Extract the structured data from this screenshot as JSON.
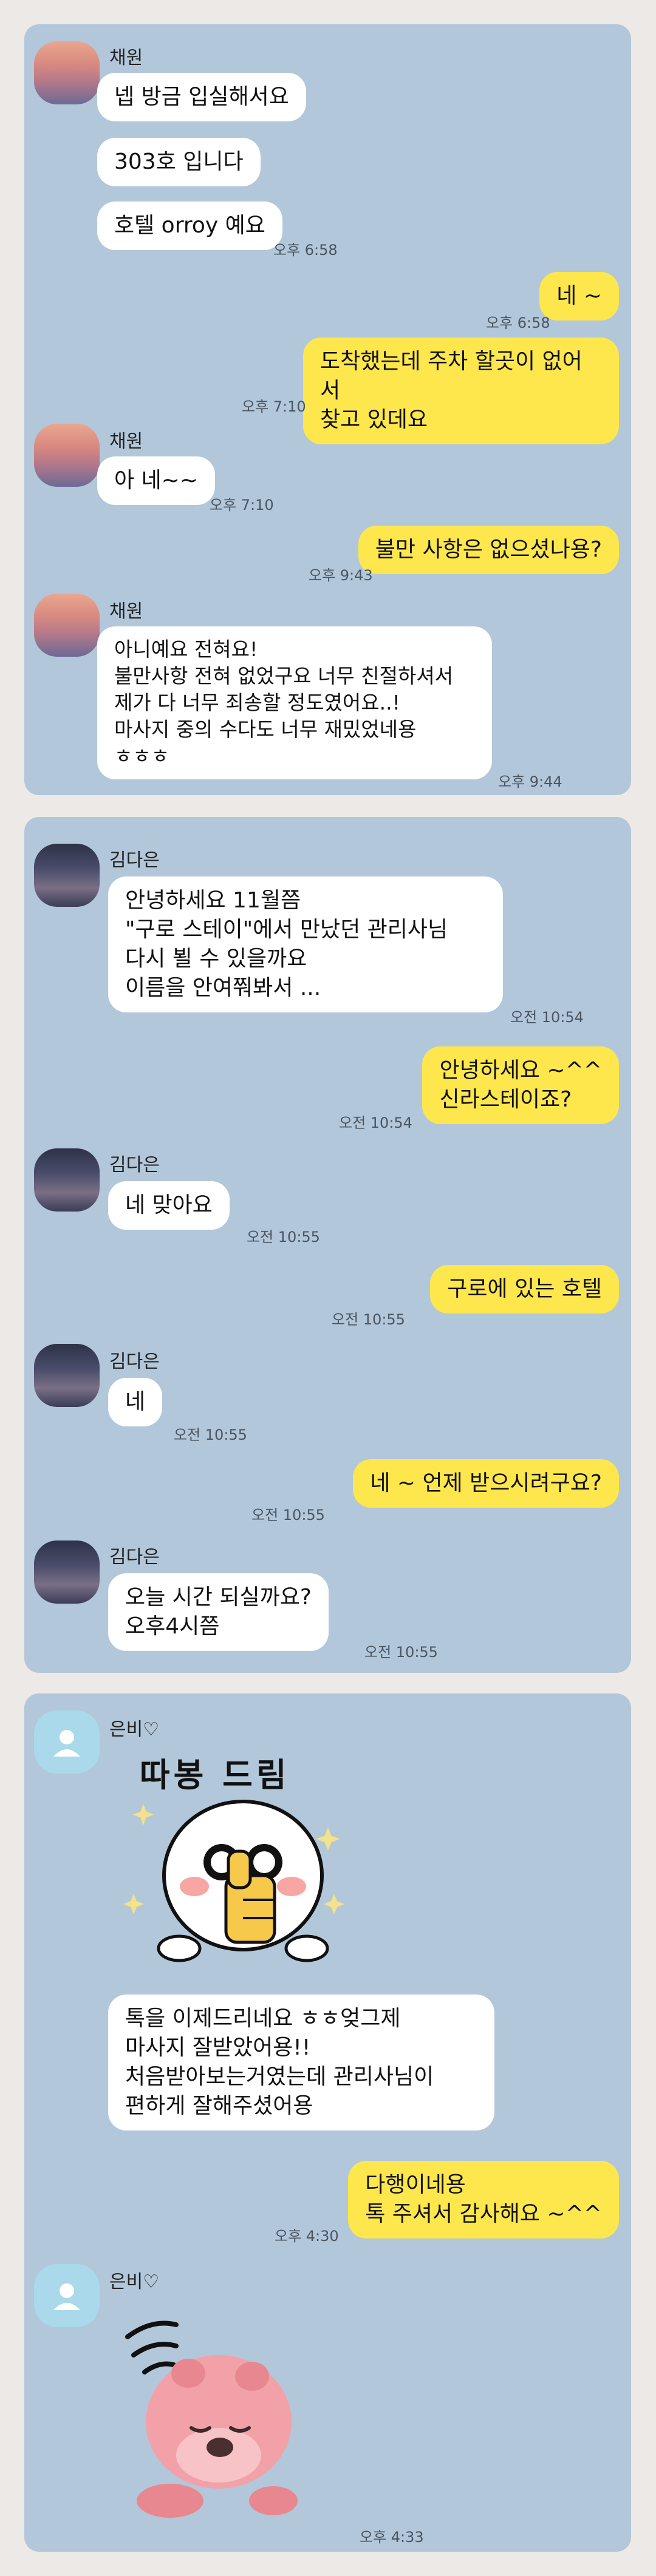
{
  "panel1": {
    "sender": "채원",
    "m1": "넵 방금 입실해서요",
    "m2": "303호 입니다",
    "m3": "호텔 orroy 예요",
    "t3": "오후 6:58",
    "o1": "네 ~",
    "to1": "오후 6:58",
    "o2": "도착했는데  주차 할곳이 없어서\n찾고 있데요",
    "to2": "오후 7:10",
    "m4": "아 네~~",
    "t4": "오후 7:10",
    "o3": "불만 사항은 없으셨나용?",
    "to3": "오후 9:43",
    "m5": "아니예요 전혀요!\n불만사항 전혀 없었구요 너무 친절하셔서\n제가 다 너무 죄송할 정도였어요..!\n마사지 중의 수다도 너무 재밌었네용\nㅎㅎㅎ",
    "t5": "오후 9:44"
  },
  "panel2": {
    "sender": "김다은",
    "m1": "안녕하세요 11월쯤\n\"구로 스테이\"에서 만났던 관리사님\n다시 뵐 수 있을까요\n이름을 안여쭤봐서 ...",
    "t1": "오전 10:54",
    "o1": "안녕하세요 ~^^\n신라스테이죠?",
    "to1": "오전 10:54",
    "m2": "네 맞아요",
    "t2": "오전 10:55",
    "o2": "구로에 있는 호텔",
    "to2": "오전 10:55",
    "m3": "네",
    "t3": "오전 10:55",
    "o3": "네 ~ 언제 받으시려구요?",
    "to3": "오전 10:55",
    "m4": "오늘  시간 되실까요?\n오후4시쯤",
    "t4": "오전 10:55"
  },
  "panel3": {
    "sender": "은비♡",
    "sticker_text": "따봉 드림",
    "m1": "톡을 이제드리네요 ㅎㅎ엊그제\n마사지 잘받았어용!!\n처음받아보는거였는데 관리사님이\n편하게 잘해주셨어용",
    "o1": "다행이네용\n톡 주셔서 감사해요 ~^^",
    "to1": "오후 4:30",
    "t_last": "오후 4:33"
  },
  "colors": {
    "panel_bg": "#b2c7da",
    "incoming_bubble": "#ffffff",
    "outgoing_bubble": "#fde74c",
    "page_bg": "#ece9e6"
  }
}
